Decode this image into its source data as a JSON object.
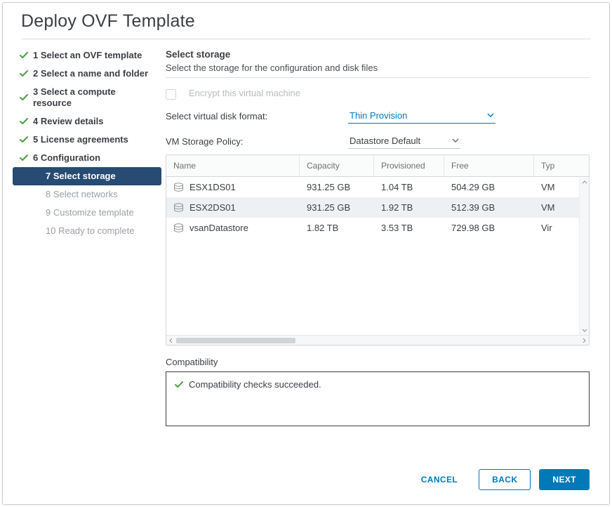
{
  "title": "Deploy OVF Template",
  "nav": {
    "items": [
      {
        "label": "1 Select an OVF template",
        "state": "done"
      },
      {
        "label": "2 Select a name and folder",
        "state": "done"
      },
      {
        "label": "3 Select a compute resource",
        "state": "done"
      },
      {
        "label": "4 Review details",
        "state": "done"
      },
      {
        "label": "5 License agreements",
        "state": "done"
      },
      {
        "label": "6 Configuration",
        "state": "done"
      },
      {
        "label": "7 Select storage",
        "state": "active"
      },
      {
        "label": "8 Select networks",
        "state": "pending"
      },
      {
        "label": "9 Customize template",
        "state": "pending"
      },
      {
        "label": "10 Ready to complete",
        "state": "pending"
      }
    ]
  },
  "section": {
    "title": "Select storage",
    "subtitle": "Select the storage for the configuration and disk files"
  },
  "encrypt": {
    "label": "Encrypt this virtual machine",
    "checked": false,
    "enabled": false
  },
  "diskFormat": {
    "label": "Select virtual disk format:",
    "value": "Thin Provision"
  },
  "storagePolicy": {
    "label": "VM Storage Policy:",
    "value": "Datastore Default"
  },
  "table": {
    "headers": {
      "name": "Name",
      "capacity": "Capacity",
      "provisioned": "Provisioned",
      "free": "Free",
      "type": "Typ"
    },
    "rows": [
      {
        "name": "ESX1DS01",
        "capacity": "931.25 GB",
        "provisioned": "1.04 TB",
        "free": "504.29 GB",
        "type": "VM",
        "selected": false
      },
      {
        "name": "ESX2DS01",
        "capacity": "931.25 GB",
        "provisioned": "1.92 TB",
        "free": "512.39 GB",
        "type": "VM",
        "selected": true
      },
      {
        "name": "vsanDatastore",
        "capacity": "1.82 TB",
        "provisioned": "3.53 TB",
        "free": "729.98 GB",
        "type": "Vir",
        "selected": false
      }
    ]
  },
  "compat": {
    "title": "Compatibility",
    "message": "Compatibility checks succeeded."
  },
  "footer": {
    "cancel": "Cancel",
    "back": "Back",
    "next": "Next"
  }
}
